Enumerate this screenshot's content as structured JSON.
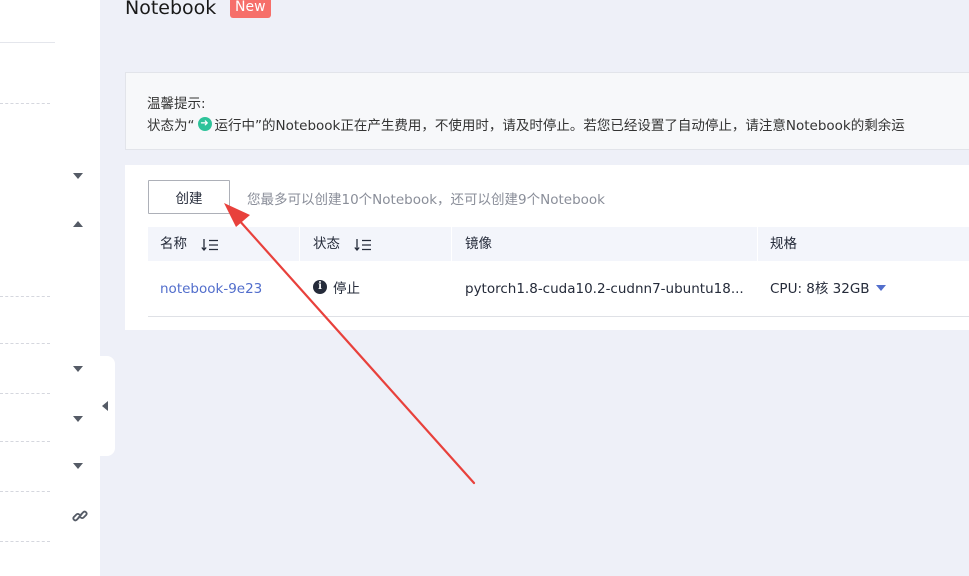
{
  "header": {
    "title": "Notebook",
    "badge": "New"
  },
  "tip": {
    "title": "温馨提示:",
    "text_before": "状态为“",
    "status_word": "运行中",
    "text_after": "”的Notebook正在产生费用，不使用时，请及时停止。若您已经设置了自动停止，请注意Notebook的剩余运"
  },
  "toolbar": {
    "create_label": "创建",
    "quota_text": "您最多可以创建10个Notebook，还可以创建9个Notebook"
  },
  "table": {
    "columns": [
      "名称",
      "状态",
      "镜像",
      "规格"
    ],
    "rows": [
      {
        "name": "notebook-9e23",
        "status": "停止",
        "image": "pytorch1.8-cuda10.2-cudnn7-ubuntu18...",
        "spec": "CPU: 8核 32GB"
      }
    ]
  },
  "icons": {
    "run_status": "arrow-right-circle-icon",
    "stop_status": "info-icon",
    "sidebar_link": "link-icon"
  },
  "colors": {
    "accent": "#526ecc",
    "badge": "#f66f6a",
    "running": "#2ec39a",
    "annotation_arrow": "#e8413c"
  }
}
